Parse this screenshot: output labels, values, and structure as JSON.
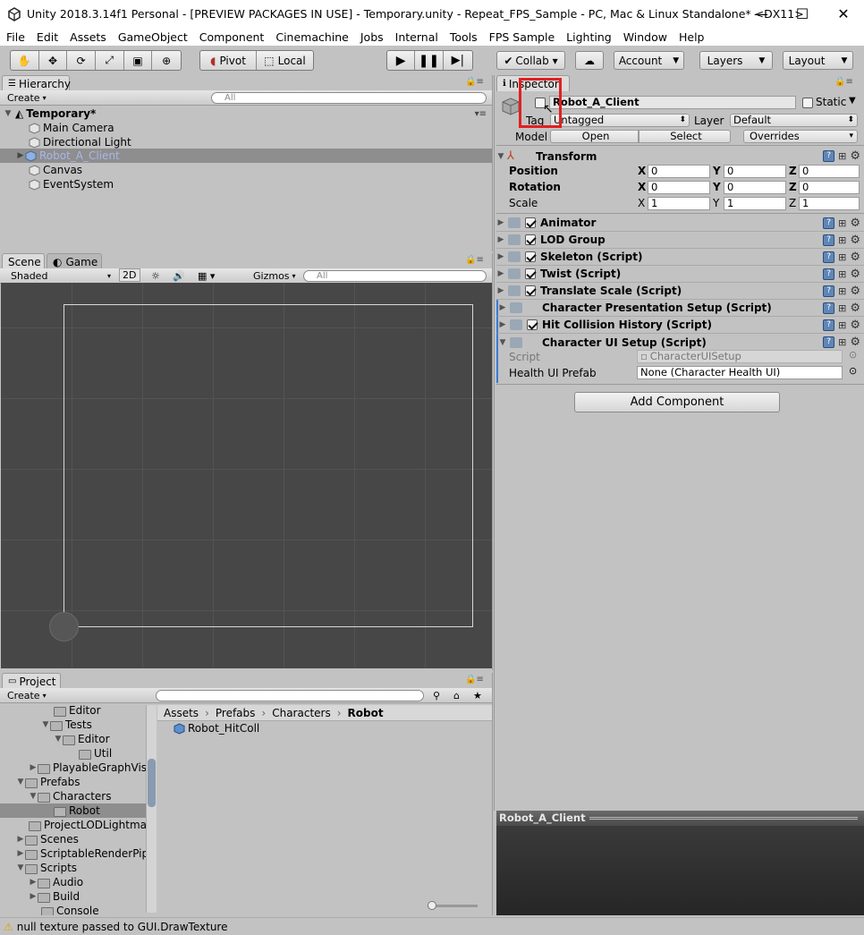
{
  "window": {
    "title": "Unity 2018.3.14f1 Personal - [PREVIEW PACKAGES IN USE] - Temporary.unity - Repeat_FPS_Sample - PC, Mac & Linux Standalone* <DX11>",
    "minimize": "—",
    "maximize": "☐",
    "close": "✕"
  },
  "menu": [
    "File",
    "Edit",
    "Assets",
    "GameObject",
    "Component",
    "Cinemachine",
    "Jobs",
    "Internal",
    "Tools",
    "FPS Sample",
    "Lighting",
    "Window",
    "Help"
  ],
  "toolbar": {
    "pivot": "Pivot",
    "local": "Local",
    "collab": "Collab ▾",
    "account": "Account",
    "layers": "Layers",
    "layout": "Layout"
  },
  "hierarchy": {
    "tab": "Hierarchy",
    "create": "Create",
    "search_placeholder": "All",
    "scene": "Temporary*",
    "items": [
      "Main Camera",
      "Directional Light",
      "Robot_A_Client",
      "Canvas",
      "EventSystem"
    ]
  },
  "scene_view": {
    "tab_scene": "Scene",
    "tab_game": "Game",
    "shading": "Shaded",
    "mode_2d": "2D",
    "gizmos": "Gizmos",
    "search_placeholder": "All"
  },
  "project": {
    "tab": "Project",
    "create": "Create",
    "tree": [
      "Editor",
      "Tests",
      "Editor",
      "Util",
      "PlayableGraphVis",
      "Prefabs",
      "Characters",
      "Robot",
      "ProjectLODLightmap",
      "Scenes",
      "ScriptableRenderPip",
      "Scripts",
      "Audio",
      "Build",
      "Console"
    ],
    "breadcrumb": [
      "Assets",
      "Prefabs",
      "Characters",
      "Robot"
    ],
    "assets": [
      "Robot_HitColl"
    ]
  },
  "inspector": {
    "tab": "Inspector",
    "object_name": "Robot_A_Client",
    "static_label": "Static",
    "tag_label": "Tag",
    "tag_value": "Untagged",
    "layer_label": "Layer",
    "layer_value": "Default",
    "model_label": "Model",
    "open": "Open",
    "select": "Select",
    "overrides": "Overrides",
    "transform": {
      "title": "Transform",
      "position_label": "Position",
      "rotation_label": "Rotation",
      "scale_label": "Scale",
      "axis_x": "X",
      "axis_y": "Y",
      "axis_z": "Z",
      "position": [
        "0",
        "0",
        "0"
      ],
      "rotation": [
        "0",
        "0",
        "0"
      ],
      "scale": [
        "1",
        "1",
        "1"
      ]
    },
    "components": [
      "Animator",
      "LOD Group",
      "Skeleton (Script)",
      "Twist (Script)",
      "Translate Scale (Script)",
      "Character Presentation Setup (Script)",
      "Hit Collision History (Script)",
      "Character UI Setup (Script)"
    ],
    "script_label": "Script",
    "script_value": "CharacterUISetup",
    "health_label": "Health UI Prefab",
    "health_value": "None (Character Health UI)",
    "add_component": "Add Component",
    "preview_title": "Robot_A_Client"
  },
  "status": {
    "message": "null texture passed to GUI.DrawTexture"
  }
}
